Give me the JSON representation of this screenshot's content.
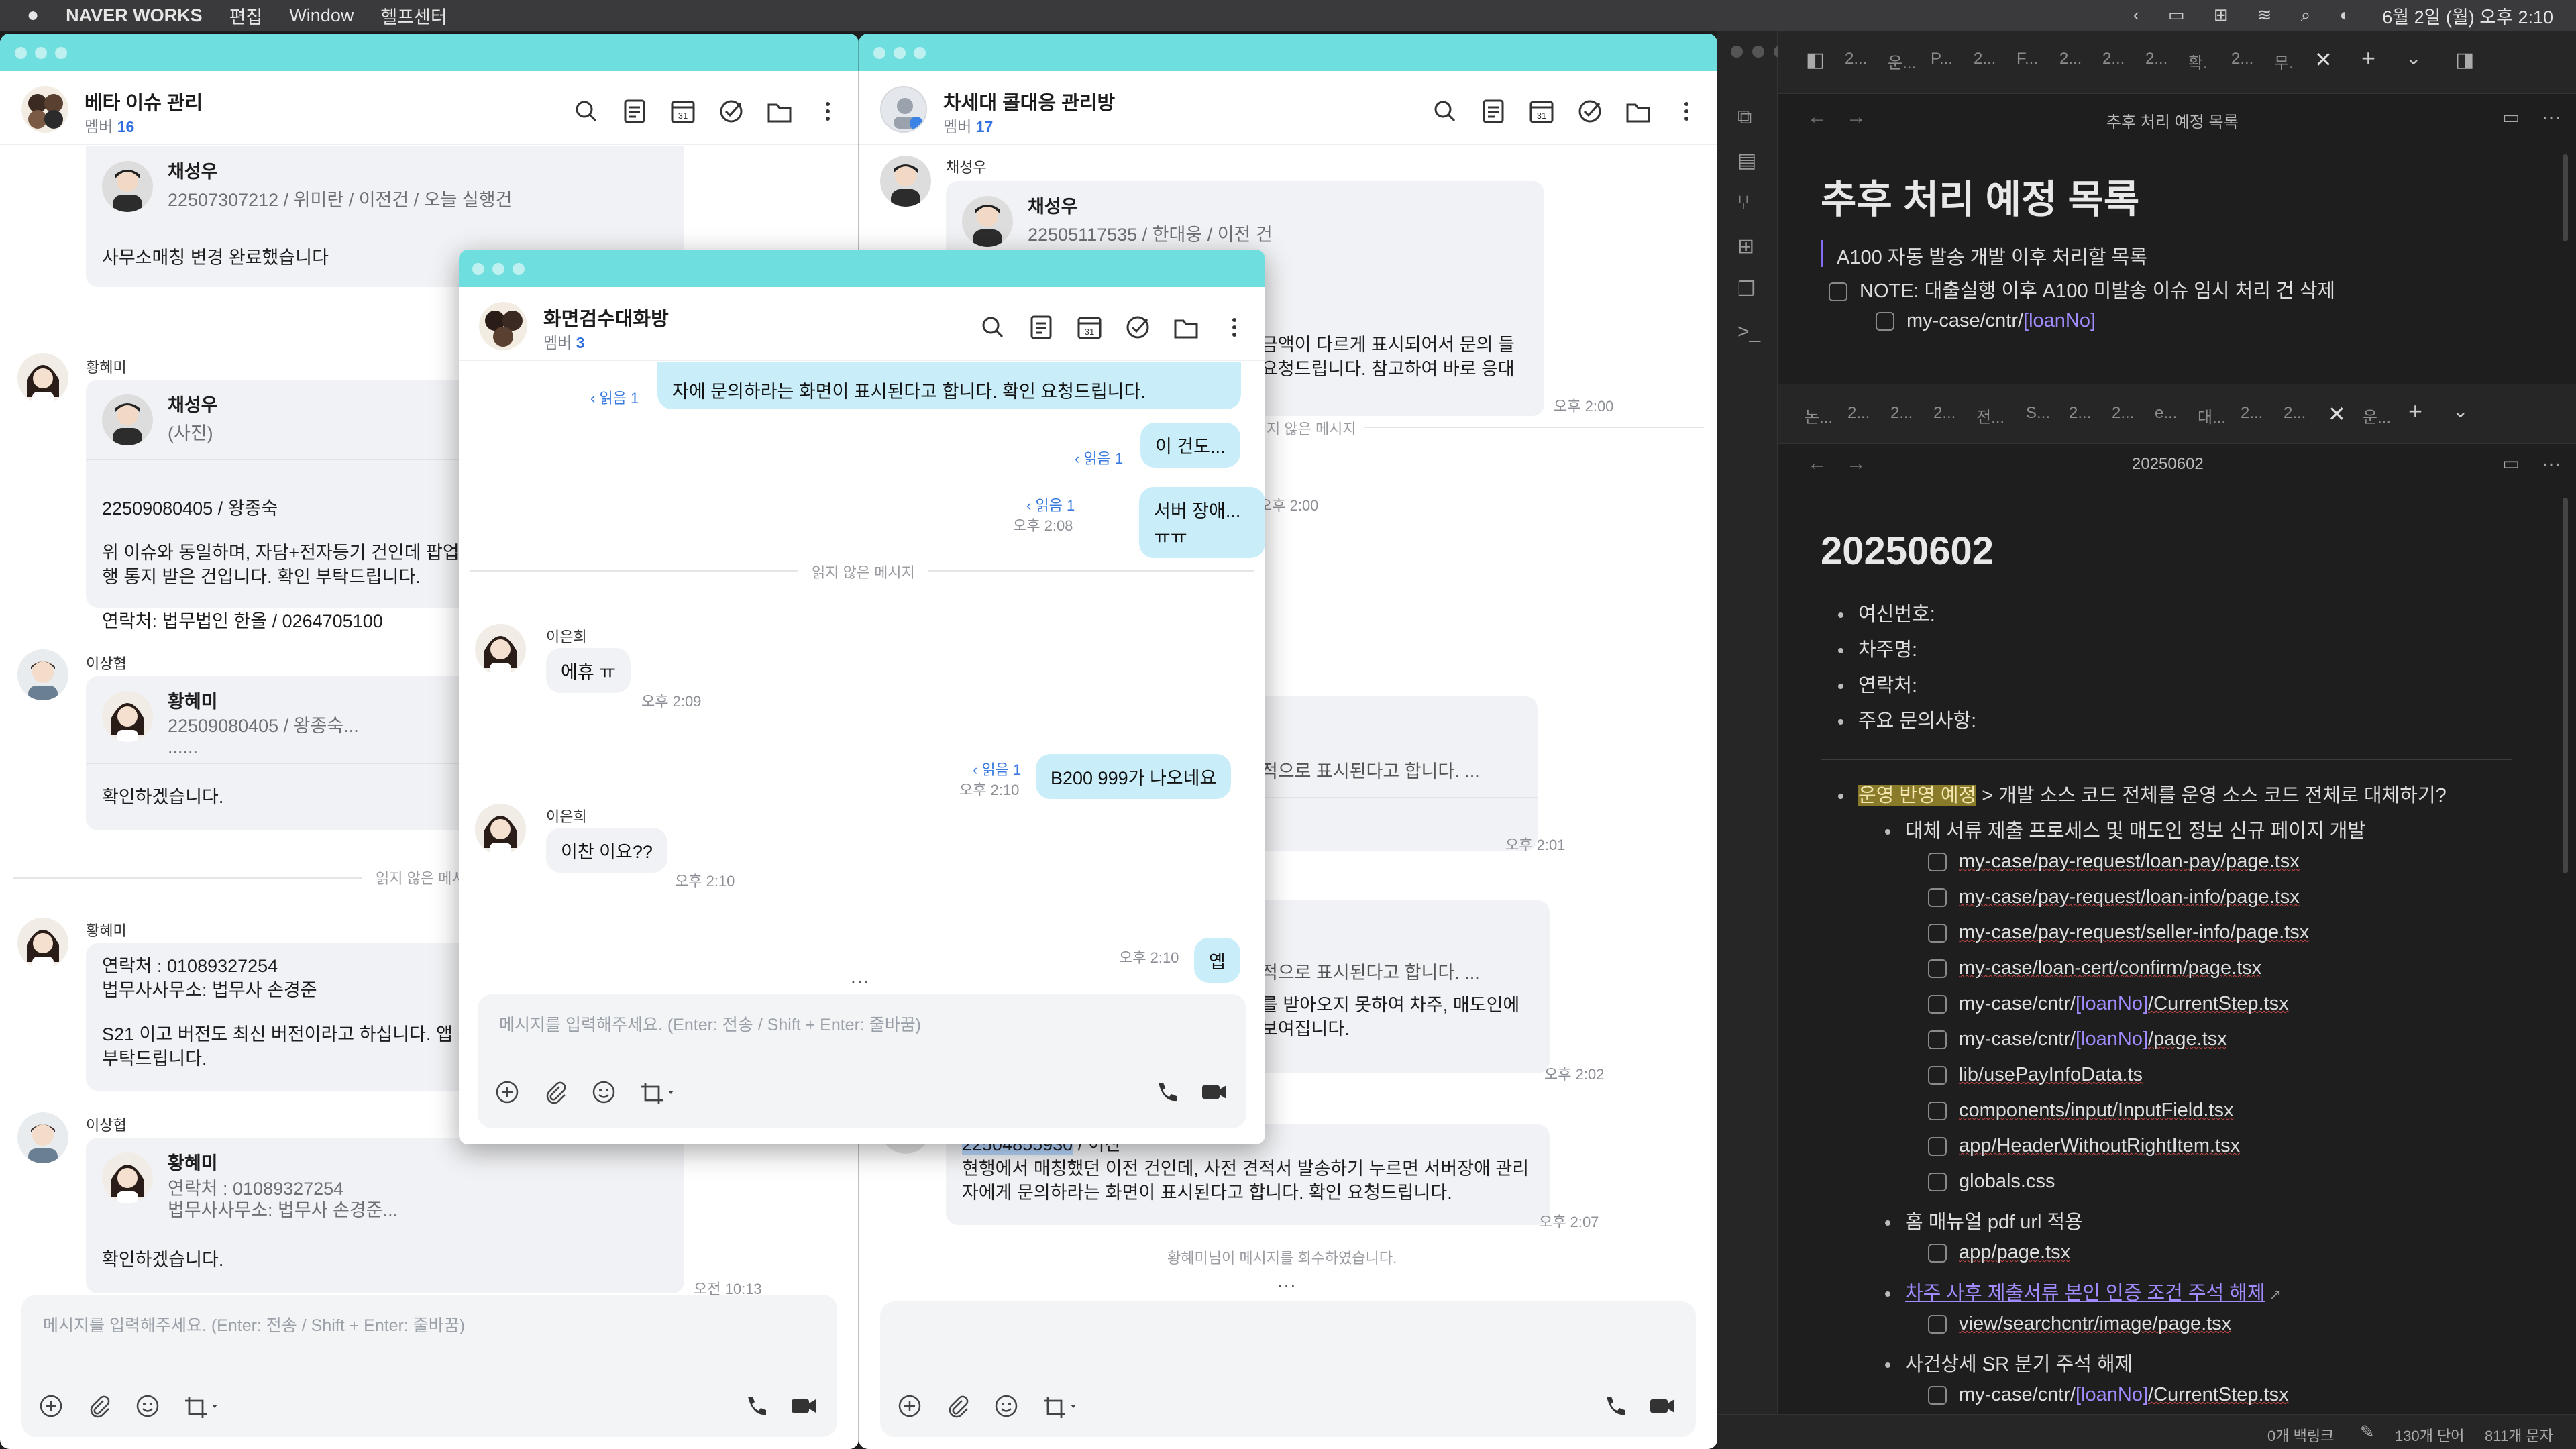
{
  "menubar": {
    "app": "NAVER WORKS",
    "menus": [
      "편집",
      "Window",
      "헬프센터"
    ],
    "datetime": "6월 2일 (월) 오후 2:10"
  },
  "left_window": {
    "room_title": "베타 이슈 관리",
    "members_label": "멤버",
    "members_count": "16",
    "msg1": {
      "card_name": "채성우",
      "card_detail": "22507307212 / 위미란 / 이전건 / 오늘 실행건",
      "text": "사무소매칭 변경 완료했습니다"
    },
    "msg2": {
      "sender": "황혜미",
      "card_name": "채성우",
      "card_detail": "(사진)",
      "text_lines": [
        "22509080405 / 왕종숙",
        "",
        "위 이슈와 동일하며, 자담+전자등기 건인데 팝업",
        "행 통지 받은 건입니다. 확인 부탁드립니다.",
        "",
        "연락처: 법무법인 한올 / 0264705100"
      ]
    },
    "msg3": {
      "sender": "이상협",
      "card_name": "황혜미",
      "card_detail_lines": [
        "22509080405 / 왕종숙...",
        "......"
      ],
      "text": "확인하겠습니다."
    },
    "unread_divider": "읽지 않은 메시",
    "msg4": {
      "sender": "황혜미",
      "text_lines": [
        "연락처 : 01089327254",
        "법무사사무소: 법무사 손경준",
        "",
        "S21 이고 버전도 최신 버전이라고 하십니다. 앱 삭",
        "부탁드립니다."
      ]
    },
    "msg5": {
      "sender": "이상협",
      "card_name": "황혜미",
      "card_detail_lines": [
        "연락처 : 01089327254",
        "법무사사무소: 법무사 손경준..."
      ],
      "text": "확인하겠습니다.",
      "time": "오전 10:13"
    },
    "more": "...",
    "input_placeholder": "메시지를 입력해주세요. (Enter: 전송 / Shift + Enter: 줄바꿈)"
  },
  "mid_window": {
    "room_title": "차세대 콜대응 관리방",
    "members_label": "멤버",
    "members_count": "17",
    "msg1": {
      "sender": "채성우",
      "card_name": "채성우",
      "card_detail": "22505117535 / 한대웅 / 이전 건",
      "text_lines": [
        "금액이 다르게 표시되어서 문의 들",
        "요청드립니다. 참고하여 바로 응대"
      ],
      "time": "오후 2:00"
    },
    "divider": "지 않은 메시지",
    "time2": "오후 2:00",
    "msg3": {
      "text": "적으로 표시된다고 합니다. ...",
      "time": "오후 2:01"
    },
    "msg4": {
      "text_lines": [
        "적으로 표시된다고 합니다. ...",
        "",
        "를 받아오지 못하여 차주, 매도인에",
        "보여집니다."
      ],
      "time": "오후 2:02"
    },
    "msg5": {
      "highlight": "22504855930",
      "suffix": " / 이찬",
      "text_lines": [
        "현행에서 매칭했던 이전 건인데, 사전 견적서 발송하기 누르면 서버장애 관리",
        "자에게 문의하라는 화면이 표시된다고 합니다.  확인 요청드립니다."
      ],
      "time": "오후 2:07"
    },
    "retract": "황혜미님이 메시지를 회수하였습니다.",
    "more": "..."
  },
  "popup": {
    "room_title": "화면검수대화방",
    "members_label": "멤버",
    "members_count": "3",
    "m0": {
      "text": "자에 문의하라는 화면이 표시된다고 합니다.  확인 요청드립니다.",
      "read": "‹ 읽음 1"
    },
    "m1": {
      "text": "이 건도...",
      "read": "‹ 읽음 1"
    },
    "m2": {
      "text": "서버 장애...ㅠㅠ",
      "read": "‹ 읽음 1",
      "time": "오후 2:08"
    },
    "divider": "읽지 않은 메시지",
    "m3": {
      "sender": "이은희",
      "text": "에휴 ㅠ",
      "time": "오후 2:09"
    },
    "m4": {
      "text": "B200 999가 나오네요",
      "read": "‹ 읽음 1",
      "time": "오후 2:10"
    },
    "m5": {
      "sender": "이은희",
      "text": "이찬 이요??",
      "time": "오후 2:10"
    },
    "m6": {
      "text": "옙",
      "time": "오후 2:10"
    },
    "more": "...",
    "input_placeholder": "메시지를 입력해주세요. (Enter: 전송 / Shift + Enter: 줄바꿈)"
  },
  "obsidian": {
    "tabs_top": [
      "2...",
      "운...",
      "P...",
      "2...",
      "F...",
      "2...",
      "2...",
      "2...",
      "확.",
      "2...",
      "무."
    ],
    "note1": {
      "header": "추후 처리 예정 목록",
      "title": "추후 처리 예정 목록",
      "quote": "A100 자동 발송 개발 이후 처리할 목록",
      "task1": "NOTE: 대출실행 이후 A100 미발송 이슈 임시 처리 건 삭제",
      "task2_prefix": "my-case/cntr/",
      "task2_link": "[loanNo]"
    },
    "tabs_mid": [
      "논...",
      "2...",
      "2...",
      "2...",
      "전...",
      "S...",
      "2...",
      "2...",
      "e...",
      "대...",
      "2...",
      "2...",
      "운..."
    ],
    "note2": {
      "header": "20250602",
      "title": "20250602",
      "fields": [
        "여신번호:",
        "차주명:",
        "연락처:",
        "주요 문의사항:"
      ],
      "b1_hl": "운영 반영 예정",
      "b1_rest": " > 개발 소스 코드 전체를 운영 소스 코드 전체로 대체하기?",
      "b1_sub": "대체 서류 제출 프로세스 및 매도인 정보 신규 페이지 개발",
      "files": [
        "my-case/pay-request/loan-pay/page.tsx",
        "my-case/pay-request/loan-info/page.tsx",
        "my-case/pay-request/seller-info/page.tsx",
        "my-case/loan-cert/confirm/page.tsx"
      ],
      "file5": {
        "a": "my-case/cntr/",
        "b": "[loanNo]",
        "c": "/CurrentStep.tsx"
      },
      "file6": {
        "a": "my-case/cntr/",
        "b": "[loanNo]",
        "c": "/page.tsx"
      },
      "files2": [
        "lib/usePayInfoData.ts",
        "components/input/InputField.tsx",
        "app/HeaderWithoutRightItem.tsx",
        "globals.css"
      ],
      "b2": "홈 매뉴얼 pdf url 적용",
      "b2_file": "app/page.tsx",
      "b3_link": "차주 사후 제출서류 본인 인증 조건 주석 해제",
      "b3_file": "view/searchcntr/image/page.tsx",
      "b4": "사건상세 SR 분기 주석 해제",
      "b4_file": {
        "a": "my-case/cntr/",
        "b": "[loanNo]",
        "c": "/CurrentStep.tsx"
      }
    },
    "status": {
      "backlinks": "0개 백링크",
      "words": "130개 단어",
      "chars": "811개 문자"
    }
  }
}
